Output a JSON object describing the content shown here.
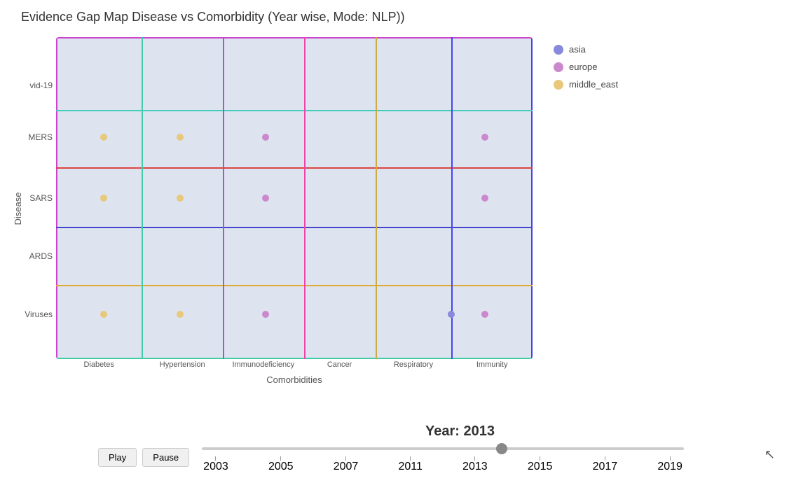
{
  "title": "Evidence Gap Map Disease vs Comorbidity (Year wise, Mode: NLP))",
  "yAxis": {
    "label": "Disease",
    "categories": [
      {
        "id": "covid19",
        "label": "vid-19",
        "yPct": 15
      },
      {
        "id": "mers",
        "label": "MERS",
        "yPct": 31
      },
      {
        "id": "sars",
        "label": "SARS",
        "yPct": 50
      },
      {
        "id": "ards",
        "label": "ARDS",
        "yPct": 68
      },
      {
        "id": "viruses",
        "label": "Viruses",
        "yPct": 86
      }
    ]
  },
  "xAxis": {
    "label": "Comorbidities",
    "categories": [
      {
        "id": "diabetes",
        "label": "Diabetes",
        "xPct": 10
      },
      {
        "id": "hypertension",
        "label": "Hypertension",
        "xPct": 26
      },
      {
        "id": "immunodeficiency",
        "label": "Immunodeficiency",
        "xPct": 44
      },
      {
        "id": "cancer",
        "label": "Cancer",
        "xPct": 59
      },
      {
        "id": "respiratory",
        "label": "Respiratory",
        "xPct": 74
      },
      {
        "id": "immunity",
        "label": "Immunity",
        "xPct": 90
      }
    ]
  },
  "legend": {
    "items": [
      {
        "id": "asia",
        "label": "asia",
        "color": "#8888dd"
      },
      {
        "id": "europe",
        "label": "europe",
        "color": "#cc88cc"
      },
      {
        "id": "middle_east",
        "label": "middle_east",
        "color": "#e8c87a"
      }
    ]
  },
  "gridRows": [
    {
      "yPct": 22.5,
      "color": "#44ccbb",
      "label": "covid19-mers boundary"
    },
    {
      "yPct": 40.5,
      "color": "#dd4444",
      "label": "mers-sars boundary"
    },
    {
      "yPct": 59,
      "color": "#4444cc",
      "label": "sars-ards boundary"
    },
    {
      "yPct": 77,
      "color": "#ddaa33",
      "label": "ards-viruses boundary"
    }
  ],
  "gridCols": [
    {
      "xPct": 18,
      "color": "#44ccaa"
    },
    {
      "xPct": 35,
      "color": "#cc44cc"
    },
    {
      "xPct": 52,
      "color": "#ee44aa"
    },
    {
      "xPct": 67,
      "color": "#ccaa44"
    },
    {
      "xPct": 83,
      "color": "#4444ee"
    }
  ],
  "outerBorder": {
    "top": "#cc44cc",
    "right": "#4444ee",
    "bottom": "#44ccaa",
    "left": "#cc44cc"
  },
  "dots": [
    {
      "id": "d1",
      "xPct": 10,
      "yPct": 31,
      "color": "#e8c87a",
      "size": 10
    },
    {
      "id": "d2",
      "xPct": 26,
      "yPct": 31,
      "color": "#e8c87a",
      "size": 10
    },
    {
      "id": "d3",
      "xPct": 44,
      "yPct": 31,
      "color": "#cc88cc",
      "size": 10
    },
    {
      "id": "d4",
      "xPct": 90,
      "yPct": 31,
      "color": "#cc88cc",
      "size": 10
    },
    {
      "id": "d5",
      "xPct": 10,
      "yPct": 50,
      "color": "#e8c87a",
      "size": 10
    },
    {
      "id": "d6",
      "xPct": 26,
      "yPct": 50,
      "color": "#e8c87a",
      "size": 10
    },
    {
      "id": "d7",
      "xPct": 44,
      "yPct": 50,
      "color": "#cc88cc",
      "size": 10
    },
    {
      "id": "d8",
      "xPct": 90,
      "yPct": 50,
      "color": "#cc88cc",
      "size": 10
    },
    {
      "id": "d9",
      "xPct": 10,
      "yPct": 86,
      "color": "#e8c87a",
      "size": 10
    },
    {
      "id": "d10",
      "xPct": 26,
      "yPct": 86,
      "color": "#e8c87a",
      "size": 10
    },
    {
      "id": "d11",
      "xPct": 44,
      "yPct": 86,
      "color": "#cc88cc",
      "size": 10
    },
    {
      "id": "d12",
      "xPct": 83,
      "yPct": 86,
      "color": "#8888dd",
      "size": 10
    },
    {
      "id": "d13",
      "xPct": 90,
      "yPct": 86,
      "color": "#cc88cc",
      "size": 10
    }
  ],
  "yearDisplay": "Year: 2013",
  "slider": {
    "min": 2003,
    "max": 2019,
    "current": 2013,
    "ticks": [
      "2003",
      "2005",
      "2007",
      "2011",
      "2013",
      "2015",
      "2017",
      "2019"
    ],
    "thumbPct": 57
  },
  "controls": {
    "play": "Play",
    "pause": "Pause"
  }
}
